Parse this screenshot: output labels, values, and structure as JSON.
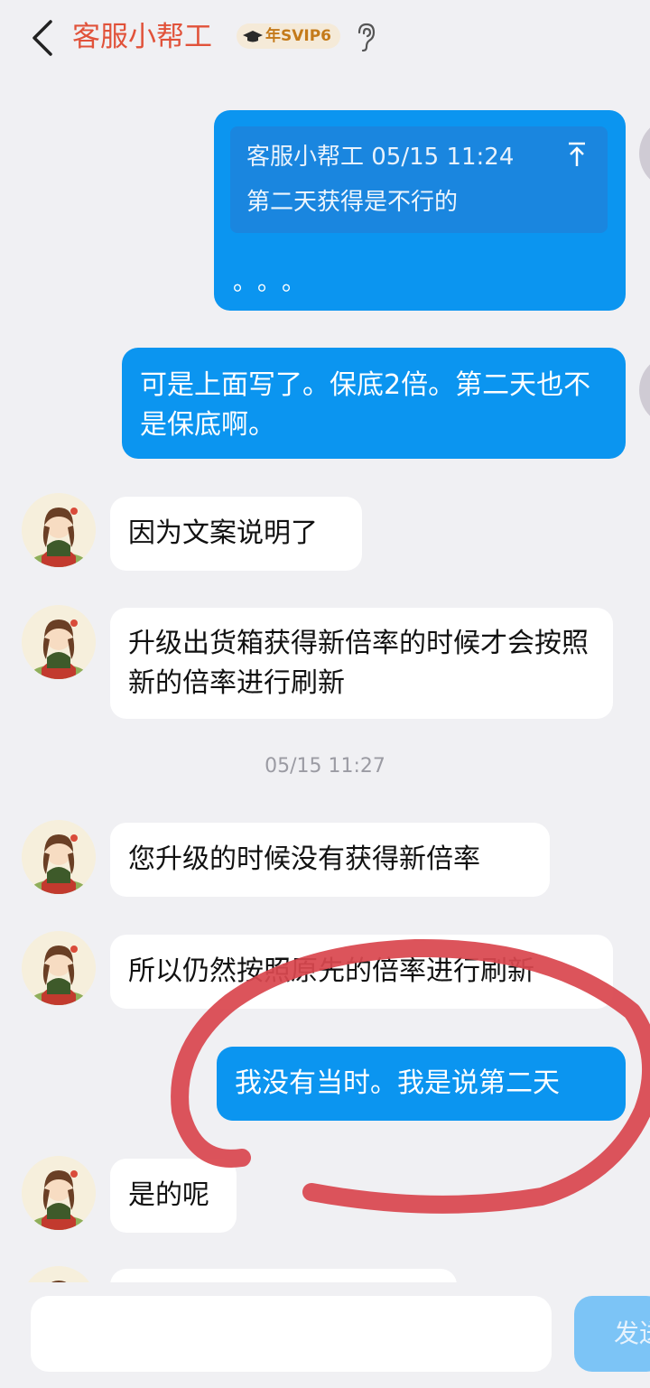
{
  "header": {
    "title": "客服小帮工",
    "badge": "年SVIP6"
  },
  "messages": {
    "quote_name_time": "客服小帮工 05/15 11:24",
    "quote_text": "第二天获得是不行的",
    "quote_dots": "。。。",
    "out1": "可是上面写了。保底2倍。第二天也不是保底啊。",
    "in1": "因为文案说明了",
    "in2": "升级出货箱获得新倍率的时候才会按照新的倍率进行刷新",
    "timestamp": "05/15 11:27",
    "in3": "您升级的时候没有获得新倍率",
    "in4": "所以仍然按照原先的倍率进行刷新",
    "out2": "我没有当时。我是说第二天",
    "in5": "是的呢"
  },
  "composer": {
    "send_label": "发送"
  },
  "colors": {
    "title": "#e1523a",
    "outgoing_bubble": "#0b95f0",
    "annotation": "#d9474f"
  }
}
